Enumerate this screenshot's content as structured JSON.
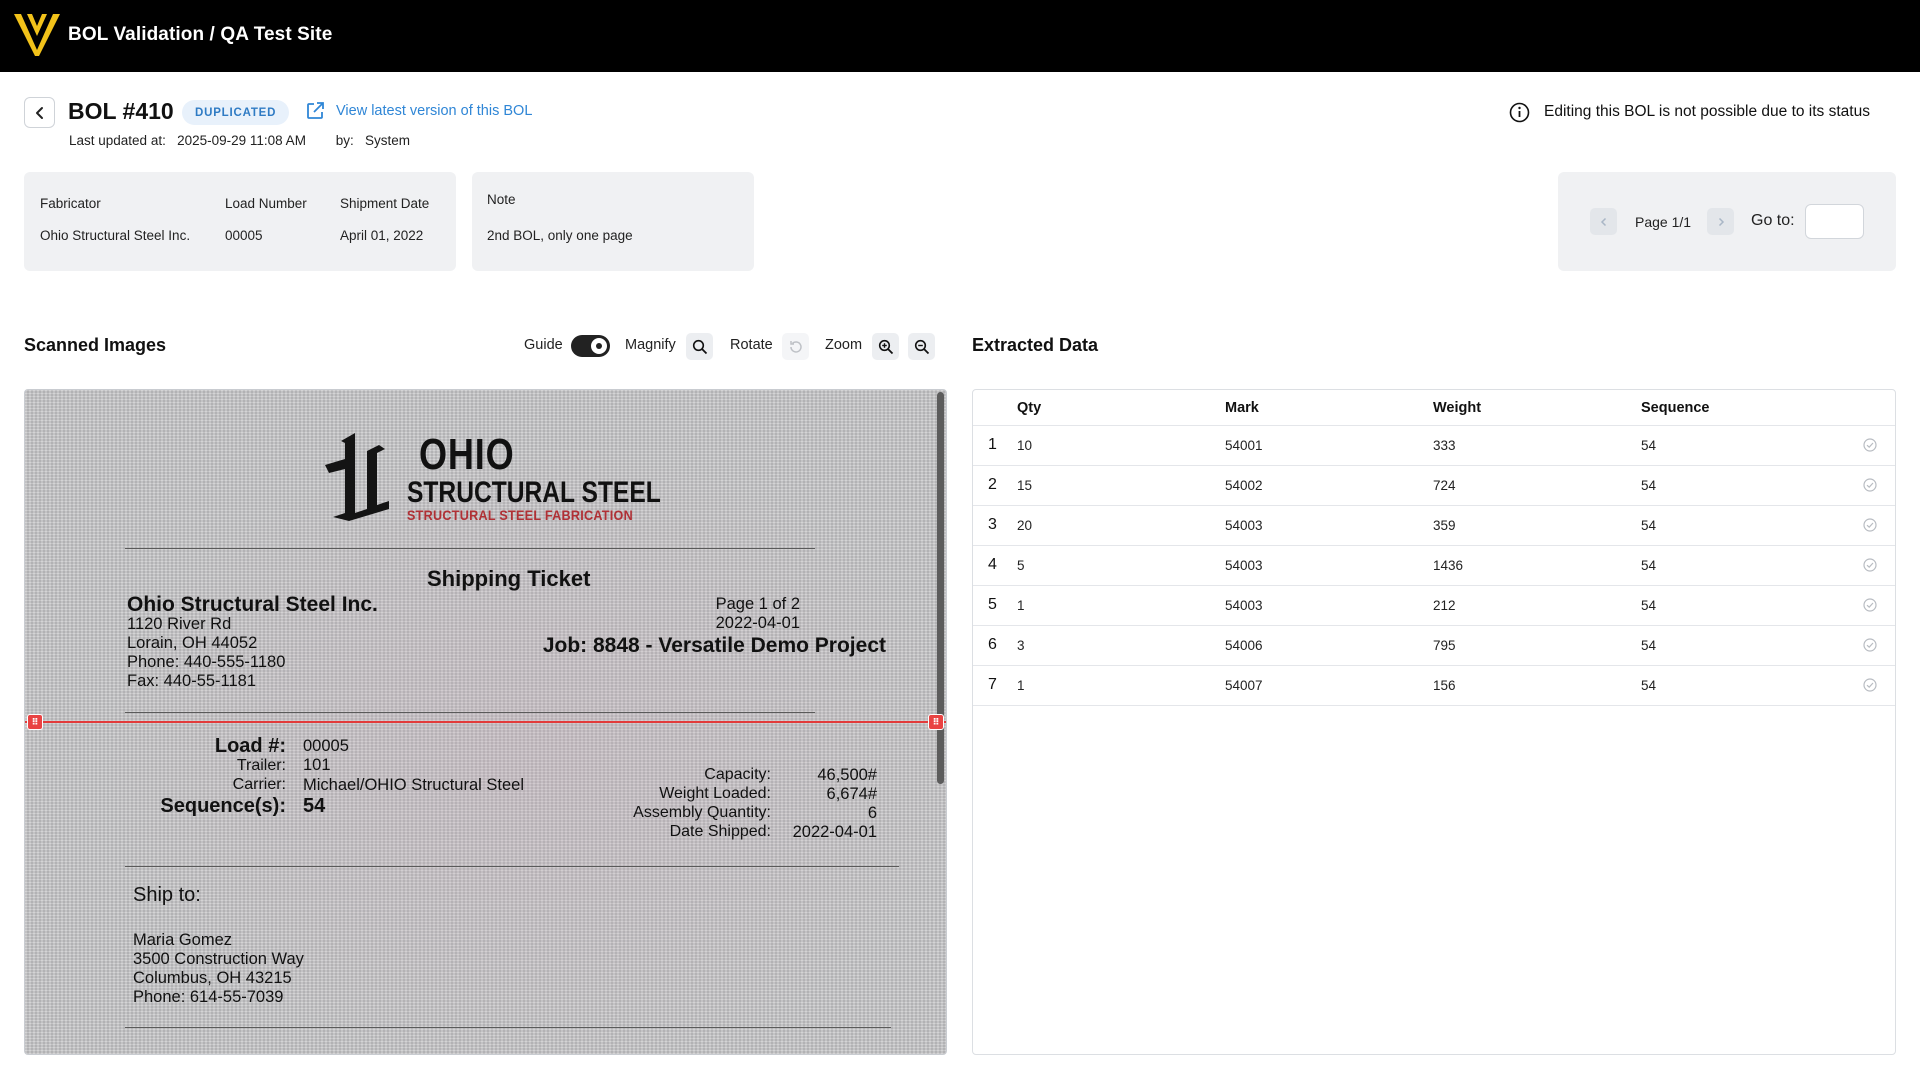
{
  "app": {
    "title": "BOL Validation / QA Test Site"
  },
  "header": {
    "bol_title": "BOL #410",
    "status": "DUPLICATED",
    "latest_link": "View latest version of this BOL",
    "updated_label": "Last updated at:",
    "updated_value": "2025-09-29 11:08 AM",
    "by_label": "by:",
    "by_value": "System",
    "edit_notice": "Editing this BOL is not possible due to its status"
  },
  "summary": {
    "fabricator_label": "Fabricator",
    "fabricator_value": "Ohio Structural Steel Inc.",
    "load_label": "Load Number",
    "load_value": "00005",
    "date_label": "Shipment Date",
    "date_value": "April 01, 2022",
    "note_label": "Note",
    "note_value": "2nd BOL, only one page"
  },
  "pager": {
    "page_text": "Page 1/1",
    "goto_label": "Go to:",
    "goto_value": ""
  },
  "scanned": {
    "title": "Scanned Images",
    "guide_label": "Guide",
    "guide_on": true,
    "magnify_label": "Magnify",
    "rotate_label": "Rotate",
    "zoom_label": "Zoom"
  },
  "document": {
    "brand": "OHIO",
    "brand_line2": "STRUCTURAL STEEL",
    "brand_sub": "STRUCTURAL STEEL FABRICATION",
    "ticket_title": "Shipping Ticket",
    "company": "Ohio Structural Steel Inc.",
    "address1": "1120 River Rd",
    "address2": "Lorain, OH 44052",
    "phone": "Phone: 440-555-1180",
    "fax": "Fax: 440-55-1181",
    "page_of": "Page 1 of 2",
    "doc_date": "2022-04-01",
    "job": "Job: 8848 - Versatile Demo Project",
    "load_label": "Load #:",
    "load_value": "00005",
    "trailer_label": "Trailer:",
    "trailer_value": "101",
    "carrier_label": "Carrier:",
    "carrier_value": "Michael/OHIO Structural Steel",
    "sequence_label": "Sequence(s):",
    "sequence_value": "54",
    "capacity_label": "Capacity:",
    "capacity_value": "46,500#",
    "weight_label": "Weight Loaded:",
    "weight_value": "6,674#",
    "assembly_label": "Assembly Quantity:",
    "assembly_value": "6",
    "shipped_label": "Date Shipped:",
    "shipped_value": "2022-04-01",
    "ship_to_label": "Ship to:",
    "ship_name": "Maria Gomez",
    "ship_addr1": "3500 Construction Way",
    "ship_addr2": "Columbus, OH 43215",
    "ship_phone": "Phone: 614-55-7039"
  },
  "extracted": {
    "title": "Extracted Data",
    "columns": [
      "Qty",
      "Mark",
      "Weight",
      "Sequence"
    ],
    "rows": [
      {
        "n": "1",
        "qty": "10",
        "mark": "54001",
        "weight": "333",
        "sequence": "54"
      },
      {
        "n": "2",
        "qty": "15",
        "mark": "54002",
        "weight": "724",
        "sequence": "54"
      },
      {
        "n": "3",
        "qty": "20",
        "mark": "54003",
        "weight": "359",
        "sequence": "54"
      },
      {
        "n": "4",
        "qty": "5",
        "mark": "54003",
        "weight": "1436",
        "sequence": "54"
      },
      {
        "n": "5",
        "qty": "1",
        "mark": "54003",
        "weight": "212",
        "sequence": "54"
      },
      {
        "n": "6",
        "qty": "3",
        "mark": "54006",
        "weight": "795",
        "sequence": "54"
      },
      {
        "n": "7",
        "qty": "1",
        "mark": "54007",
        "weight": "156",
        "sequence": "54"
      }
    ]
  },
  "colors": {
    "accent": "#2f86d6",
    "badge_bg": "#e8f1fb",
    "guide": "#e23b3b",
    "logo": "#f2c21a"
  },
  "icons": {
    "logo": "logo-icon",
    "back": "chevron-left-icon",
    "external": "external-link-icon",
    "info": "info-icon",
    "prev": "chevron-left-icon",
    "next": "chevron-right-icon",
    "magnify": "search-icon",
    "rotate": "rotate-icon",
    "zoom_in": "zoom-in-icon",
    "zoom_out": "zoom-out-icon",
    "row_status": "check-circle-icon"
  }
}
